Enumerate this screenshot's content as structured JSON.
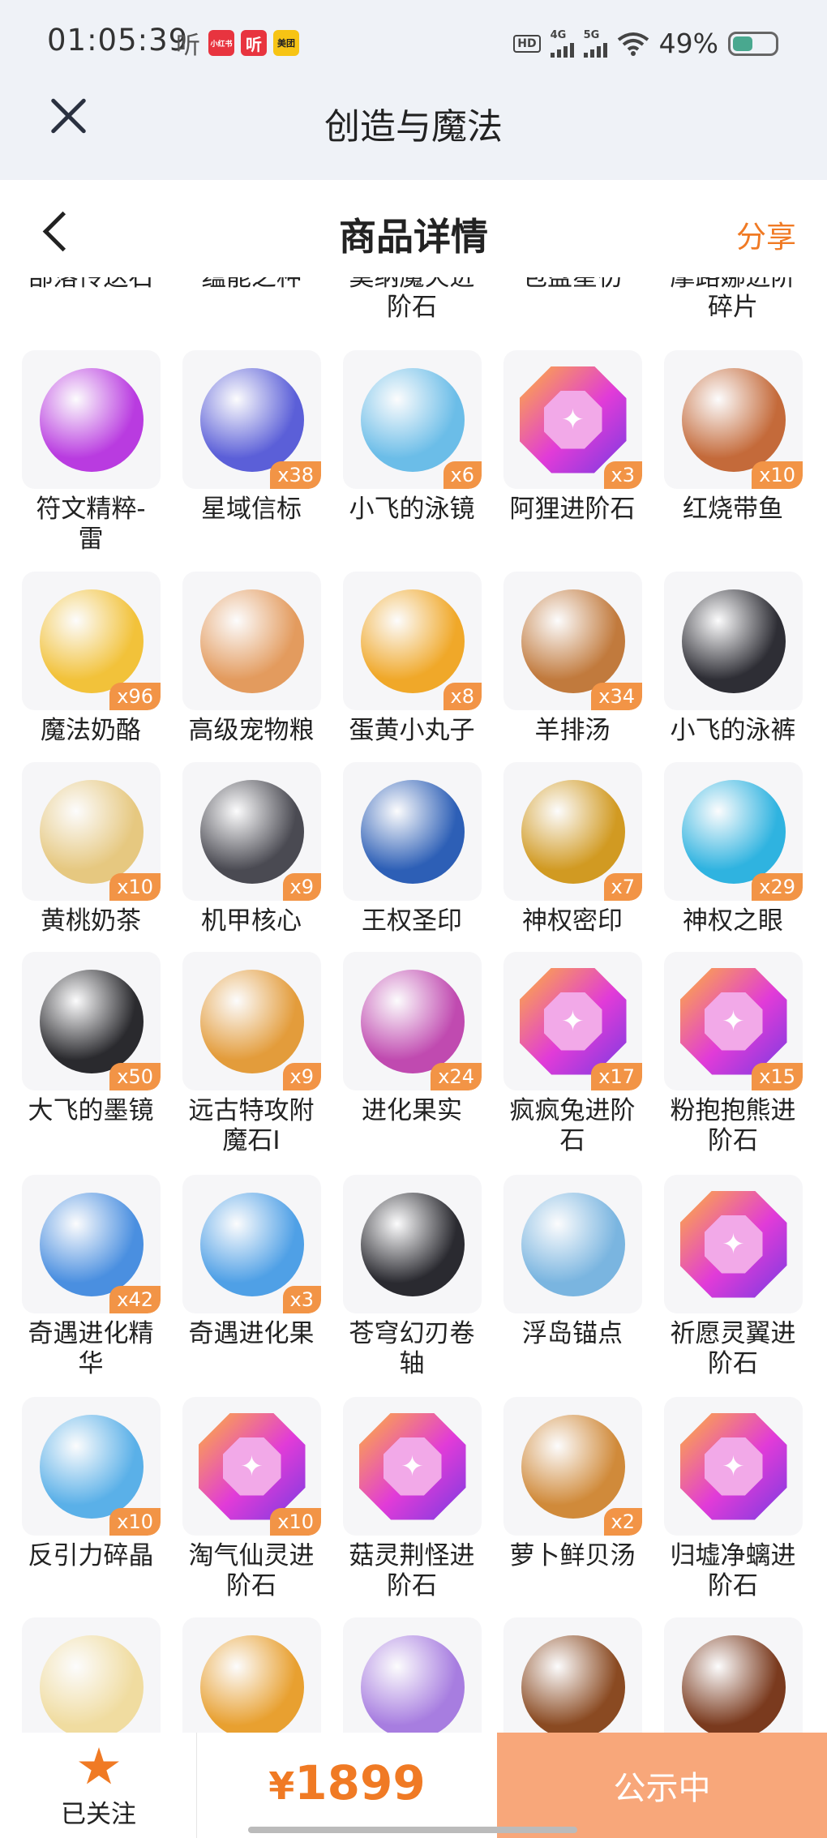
{
  "status_bar": {
    "time": "01:05:39",
    "apps": [
      "听",
      "小红书",
      "听",
      "美团"
    ],
    "network": [
      "HD",
      "4G",
      "5G"
    ],
    "battery": "49%"
  },
  "webview": {
    "title": "创造与魔法"
  },
  "header": {
    "title": "商品详情",
    "share": "分享"
  },
  "partial_row_labels": [
    "部落传送石",
    "蕴能之种",
    "莫纳魔火进\n阶石",
    "包盘星彷",
    "摩路娜进阶\n碎片"
  ],
  "items": [
    {
      "name": "符文精粹-\n雷",
      "qty": "",
      "icon": "rune-shard-icon",
      "color": "#b93be0"
    },
    {
      "name": "星域信标",
      "qty": "x38",
      "icon": "star-beacon-icon",
      "color": "#5b5fd8"
    },
    {
      "name": "小飞的泳镜",
      "qty": "x6",
      "icon": "goggles-icon",
      "color": "#6bbde8"
    },
    {
      "name": "阿狸进阶石",
      "qty": "x3",
      "icon": "fox-gem-icon",
      "color": "gem"
    },
    {
      "name": "红烧带鱼",
      "qty": "x10",
      "icon": "braised-fish-icon",
      "color": "#c46a3a"
    },
    {
      "name": "魔法奶酪",
      "qty": "x96",
      "icon": "cheese-icon",
      "color": "#f2c23a"
    },
    {
      "name": "高级宠物粮",
      "qty": "",
      "icon": "pet-food-bag-icon",
      "color": "#e39b5e"
    },
    {
      "name": "蛋黄小丸子",
      "qty": "x8",
      "icon": "yolk-skewer-icon",
      "color": "#f0a829"
    },
    {
      "name": "羊排汤",
      "qty": "x34",
      "icon": "lamb-soup-icon",
      "color": "#c17a3d"
    },
    {
      "name": "小飞的泳裤",
      "qty": "",
      "icon": "swim-shorts-icon",
      "color": "#2e2e35"
    },
    {
      "name": "黄桃奶茶",
      "qty": "x10",
      "icon": "peach-milk-tea-icon",
      "color": "#e6c880"
    },
    {
      "name": "机甲核心",
      "qty": "x9",
      "icon": "mecha-core-icon",
      "color": "#4a4a52"
    },
    {
      "name": "王权圣印",
      "qty": "",
      "icon": "royal-seal-icon",
      "color": "#2d5fb6"
    },
    {
      "name": "神权密印",
      "qty": "x7",
      "icon": "divine-seal-icon",
      "color": "#d19a22"
    },
    {
      "name": "神权之眼",
      "qty": "x29",
      "icon": "divine-eye-icon",
      "color": "#2fb3e0"
    },
    {
      "name": "大飞的墨镜",
      "qty": "x50",
      "icon": "sunglasses-icon",
      "color": "#2a2a2e"
    },
    {
      "name": "远古特攻附\n魔石I",
      "qty": "x9",
      "icon": "ancient-stone-icon",
      "color": "#e39c3b"
    },
    {
      "name": "进化果实",
      "qty": "x24",
      "icon": "evolution-fruit-icon",
      "color": "#c04ab0"
    },
    {
      "name": "疯疯兔进阶\n石",
      "qty": "x17",
      "icon": "rabbit-gem-icon",
      "color": "gem"
    },
    {
      "name": "粉抱抱熊进\n阶石",
      "qty": "x15",
      "icon": "bear-gem-icon",
      "color": "gem"
    },
    {
      "name": "奇遇进化精\n华",
      "qty": "x42",
      "icon": "adventure-essence-icon",
      "color": "#4a8fe0"
    },
    {
      "name": "奇遇进化果",
      "qty": "x3",
      "icon": "adventure-fruit-icon",
      "color": "#4fa0e6"
    },
    {
      "name": "苍穹幻刃卷\n轴",
      "qty": "",
      "icon": "scroll-icon",
      "color": "#2a2a30"
    },
    {
      "name": "浮岛锚点",
      "qty": "",
      "icon": "anchor-icon",
      "color": "#7ab5e0"
    },
    {
      "name": "祈愿灵翼进\n阶石",
      "qty": "",
      "icon": "wing-gem-icon",
      "color": "gem"
    },
    {
      "name": "反引力碎晶",
      "qty": "x10",
      "icon": "antigravity-crystal-icon",
      "color": "#5ab0e8"
    },
    {
      "name": "淘气仙灵进\n阶石",
      "qty": "x10",
      "icon": "fairy-gem-icon",
      "color": "gem"
    },
    {
      "name": "菇灵荆怪进\n阶石",
      "qty": "",
      "icon": "mushroom-gem-icon",
      "color": "gem"
    },
    {
      "name": "萝卜鲜贝汤",
      "qty": "x2",
      "icon": "radish-soup-icon",
      "color": "#d08a3a"
    },
    {
      "name": "归墟净螭进\n阶石",
      "qty": "",
      "icon": "dragon-gem-icon",
      "color": "gem"
    },
    {
      "name": "",
      "qty": "",
      "icon": "milk-jar-icon",
      "color": "#f0dca0"
    },
    {
      "name": "",
      "qty": "",
      "icon": "lucky-bag-icon",
      "color": "#e8a030"
    },
    {
      "name": "",
      "qty": "",
      "icon": "potion-bottle-icon",
      "color": "#a77de0"
    },
    {
      "name": "",
      "qty": "",
      "icon": "wood-log-icon",
      "color": "#8a4a22"
    },
    {
      "name": "",
      "qty": "",
      "icon": "roasted-egg-icon",
      "color": "#7a3a1e"
    }
  ],
  "bottom": {
    "follow_label": "已关注",
    "currency": "¥",
    "price": "1899",
    "status_button": "公示中"
  }
}
